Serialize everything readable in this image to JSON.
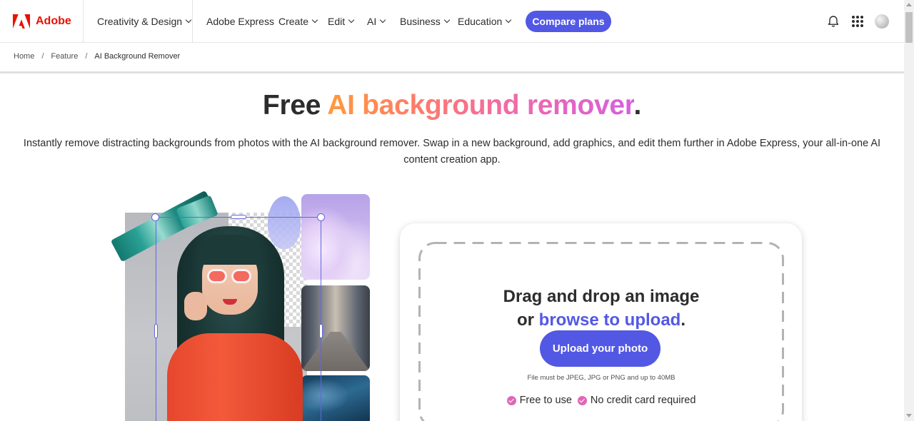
{
  "nav": {
    "brand": "Adobe",
    "creativity": "Creativity & Design",
    "items": [
      "Adobe Express",
      "Create",
      "Edit",
      "AI",
      "Business",
      "Education"
    ],
    "cta": "Compare plans",
    "icons": [
      "adobe-logo-icon",
      "bell-icon",
      "app-switcher-icon",
      "profile-avatar"
    ]
  },
  "breadcrumb": {
    "home": "Home",
    "feature": "Feature",
    "current": "AI Background Remover",
    "separator": "/"
  },
  "hero": {
    "title_prefix": "Free",
    "title_highlight": "AI background remover",
    "title_suffix": ".",
    "subtitle": "Instantly remove distracting backgrounds from photos with the AI background remover. Swap in a new background, add graphics, and edit them further in Adobe Express, your all-in-one AI content creation app."
  },
  "upload": {
    "line1": "Drag and drop an image",
    "line2_prefix": "or",
    "browse_link": "browse to upload",
    "line2_suffix": ".",
    "button": "Upload your photo",
    "note": "File must be JPEG, JPG or PNG and up to 40MB",
    "badge1": "Free to use",
    "badge2": "No credit card required"
  },
  "colors": {
    "brand_red": "#eb1000",
    "accent": "#5258e4",
    "check_pink": "#e066b7"
  }
}
